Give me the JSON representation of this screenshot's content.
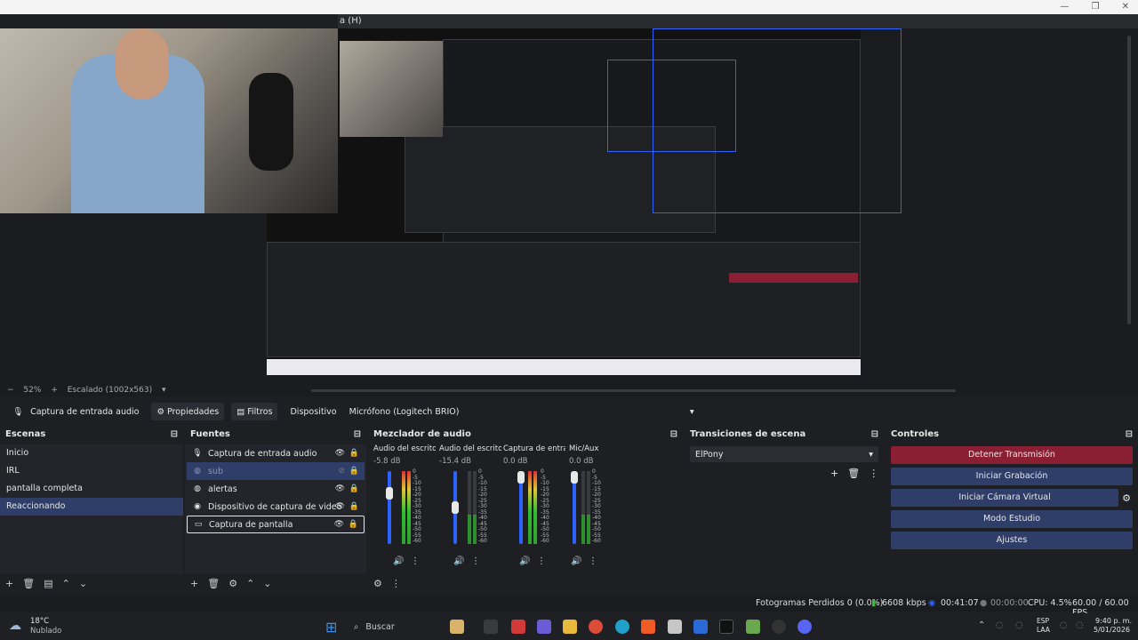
{
  "window": {
    "title_fragment": "a (H)",
    "controls": [
      "—",
      "❐",
      "✕"
    ]
  },
  "preview": {
    "zoom": "52%",
    "scale_label": "Escalado (1002x563)"
  },
  "propbar": {
    "source_name": "Captura de entrada audio",
    "properties_label": "Propiedades",
    "filters_label": "Filtros",
    "device_label": "Dispositivo",
    "device_value": "Micrófono (Logitech BRIO)"
  },
  "scenes": {
    "title": "Escenas",
    "items": [
      "Inicio",
      "IRL",
      "pantalla completa",
      "Reaccionando"
    ],
    "selected_index": 3
  },
  "sources": {
    "title": "Fuentes",
    "items": [
      {
        "label": "Captura de entrada audio",
        "icon": "mic-icon"
      },
      {
        "label": "sub",
        "icon": "browser-icon"
      },
      {
        "label": "alertas",
        "icon": "browser-icon"
      },
      {
        "label": "Dispositivo de captura de video",
        "icon": "camera-icon"
      },
      {
        "label": "Captura de pantalla",
        "icon": "monitor-icon"
      }
    ]
  },
  "mixer": {
    "title": "Mezclador de audio",
    "channels": [
      {
        "name": "Audio del escritorio",
        "db": "-5.8 dB",
        "level": 0.55
      },
      {
        "name": "Audio del escritorio",
        "db": "-15.4 dB",
        "level": 0.35
      },
      {
        "name": "Captura de entrada",
        "db": "0.0 dB",
        "level": 0.9
      },
      {
        "name": "Mic/Aux",
        "db": "0.0 dB",
        "level": 0.9
      }
    ],
    "ticks": [
      "0",
      "-5",
      "-10",
      "-15",
      "-20",
      "-25",
      "-30",
      "-35",
      "-40",
      "-45",
      "-50",
      "-55",
      "-60"
    ]
  },
  "transitions": {
    "title": "Transiciones de escena",
    "selected": "ElPony"
  },
  "controls": {
    "title": "Controles",
    "buttons": [
      "Detener Transmisión",
      "Iniciar Grabación",
      "Iniciar Cámara Virtual",
      "Modo Estudio",
      "Ajustes"
    ]
  },
  "statusbar": {
    "dropped_frames": "Fotogramas Perdidos 0 (0.0%)",
    "bitrate": "6608 kbps",
    "stream_time": "00:41:07",
    "rec_time": "00:00:00",
    "cpu": "CPU: 4.5%",
    "fps": "60.00 / 60.00 FPS"
  },
  "taskbar": {
    "weather_temp": "18°C",
    "weather_desc": "Nublado",
    "search_placeholder": "Buscar",
    "lang_top": "ESP",
    "lang_bottom": "LAA",
    "clock_time": "9:40 p. m.",
    "clock_date": "5/01/2026"
  },
  "colors": {
    "accent": "#2f3e68",
    "stop_button": "#8a1f33",
    "background": "#1e1f22"
  }
}
